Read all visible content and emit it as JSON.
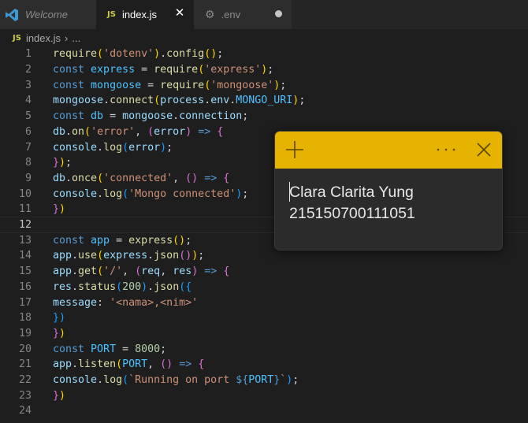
{
  "tabs": {
    "welcome": "Welcome",
    "index": "index.js",
    "env": ".env",
    "js_badge": "JS",
    "close_glyph": "✕"
  },
  "breadcrumb": {
    "badge": "JS",
    "file": "index.js",
    "sep": "›",
    "more": "..."
  },
  "editor": {
    "current_line": 12,
    "lines": [
      {
        "n": "1"
      },
      {
        "n": "2"
      },
      {
        "n": "3"
      },
      {
        "n": "4"
      },
      {
        "n": "5"
      },
      {
        "n": "6"
      },
      {
        "n": "7"
      },
      {
        "n": "8"
      },
      {
        "n": "9"
      },
      {
        "n": "10"
      },
      {
        "n": "11"
      },
      {
        "n": "12"
      },
      {
        "n": "13"
      },
      {
        "n": "14"
      },
      {
        "n": "15"
      },
      {
        "n": "16"
      },
      {
        "n": "17"
      },
      {
        "n": "18"
      },
      {
        "n": "19"
      },
      {
        "n": "20"
      },
      {
        "n": "21"
      },
      {
        "n": "22"
      },
      {
        "n": "23"
      },
      {
        "n": "24"
      }
    ]
  },
  "note": {
    "text_line1": "Clara Clarita Yung",
    "text_line2": "215150700111051",
    "header_color": "#e6b400"
  },
  "colors": {
    "keyword": "#569cd6",
    "variable": "#9cdcfe",
    "function": "#dcdcaa",
    "string": "#ce9178",
    "number": "#b5cea8"
  }
}
